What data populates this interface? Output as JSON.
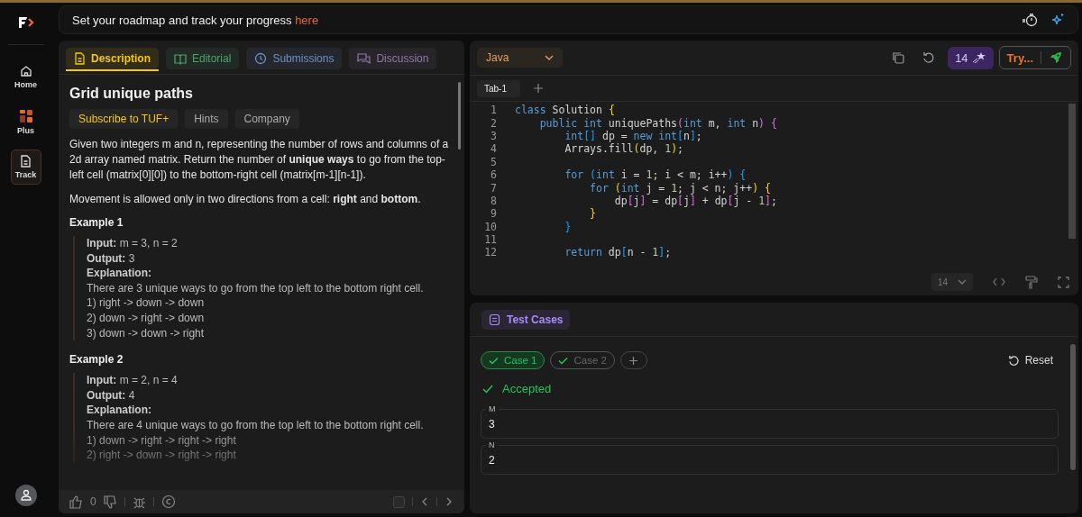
{
  "sidebar": {
    "items": [
      {
        "label": "Home",
        "selected": false
      },
      {
        "label": "Plus",
        "selected": false
      },
      {
        "label": "Track",
        "selected": true
      }
    ]
  },
  "banner": {
    "text": "Set your roadmap and track your progress ",
    "link": "here"
  },
  "problem": {
    "tabs": [
      {
        "label": "Description",
        "color": "#f5c518",
        "selected": true
      },
      {
        "label": "Editorial",
        "color": "#4fa36a",
        "selected": false
      },
      {
        "label": "Submissions",
        "color": "#6f8fc4",
        "selected": false
      },
      {
        "label": "Discussion",
        "color": "#8b7aa8",
        "selected": false
      }
    ],
    "title": "Grid unique paths",
    "chips": [
      {
        "label": "Subscribe to TUF+",
        "kind": "premium"
      },
      {
        "label": "Hints",
        "kind": "plain"
      },
      {
        "label": "Company",
        "kind": "plain"
      }
    ],
    "paragraphs": [
      "Given two integers m and n, representing the number of rows and columns of a 2d array named matrix. Return the number of **unique ways** to go from the top-left cell (matrix[0][0]) to the bottom-right cell (matrix[m-1][n-1]).",
      " Movement is allowed only in two directions from a cell: **right** and **bottom**."
    ],
    "examples": [
      {
        "heading": "Example 1",
        "lines": [
          "**Input:** m = 3, n = 2",
          "**Output:** 3",
          "**Explanation:**",
          "There are 3 unique ways to go from the top left to the bottom right cell.",
          "1) right -> down -> down",
          "2) down -> right -> down",
          "3) down -> down -> right"
        ]
      },
      {
        "heading": "Example 2",
        "lines": [
          "**Input:** m = 2, n = 4",
          "**Output:** 4",
          "**Explanation:**",
          "There are 4 unique ways to go from the top left to the bottom right cell.",
          "1) down -> right -> right -> right",
          "2) right -> down -> right -> right"
        ]
      }
    ],
    "footer": {
      "likes": "0"
    }
  },
  "editor": {
    "language": "Java",
    "streak": "14",
    "try_button": "Try...",
    "tabs": [
      {
        "label": "Tab-1",
        "selected": true
      }
    ],
    "font_size": "14",
    "lines": [
      {
        "number": "1",
        "tokens": [
          {
            "text": "class",
            "kind": "kw"
          },
          {
            "text": " Solution ",
            "kind": "plain"
          },
          {
            "text": "{",
            "kind": "b1"
          }
        ]
      },
      {
        "number": "2",
        "tokens": [
          {
            "text": "    public int",
            "kind": "kw"
          },
          {
            "text": " uniquePaths",
            "kind": "plain"
          },
          {
            "text": "(",
            "kind": "b2"
          },
          {
            "text": "int",
            "kind": "kw"
          },
          {
            "text": " m, ",
            "kind": "plain"
          },
          {
            "text": "int",
            "kind": "kw"
          },
          {
            "text": " n",
            "kind": "plain"
          },
          {
            "text": ") {",
            "kind": "b2"
          }
        ]
      },
      {
        "number": "3",
        "tokens": [
          {
            "text": "        int",
            "kind": "kw"
          },
          {
            "text": "[]",
            "kind": "b3"
          },
          {
            "text": " dp = ",
            "kind": "plain"
          },
          {
            "text": "new int",
            "kind": "kw"
          },
          {
            "text": "[",
            "kind": "b3"
          },
          {
            "text": "n",
            "kind": "plain"
          },
          {
            "text": "]",
            "kind": "b3"
          },
          {
            "text": ";",
            "kind": "plain"
          }
        ]
      },
      {
        "number": "4",
        "tokens": [
          {
            "text": "        Arrays.fill",
            "kind": "plain"
          },
          {
            "text": "(",
            "kind": "b1"
          },
          {
            "text": "dp, ",
            "kind": "plain"
          },
          {
            "text": "1",
            "kind": "num"
          },
          {
            "text": ")",
            "kind": "b1"
          },
          {
            "text": ";",
            "kind": "plain"
          }
        ]
      },
      {
        "number": "5"
      },
      {
        "number": "6",
        "tokens": [
          {
            "text": "        for",
            "kind": "kw"
          },
          {
            "text": " (",
            "kind": "b3"
          },
          {
            "text": "int",
            "kind": "kw"
          },
          {
            "text": " i = ",
            "kind": "plain"
          },
          {
            "text": "1",
            "kind": "num"
          },
          {
            "text": "; i < m; i++",
            "kind": "plain"
          },
          {
            "text": ") {",
            "kind": "b3"
          }
        ]
      },
      {
        "number": "7",
        "tokens": [
          {
            "text": "            for",
            "kind": "kw"
          },
          {
            "text": " (",
            "kind": "b1"
          },
          {
            "text": "int",
            "kind": "kw"
          },
          {
            "text": " j = ",
            "kind": "plain"
          },
          {
            "text": "1",
            "kind": "num"
          },
          {
            "text": "; j < n; j++",
            "kind": "plain"
          },
          {
            "text": ") {",
            "kind": "b1"
          }
        ]
      },
      {
        "number": "8",
        "tokens": [
          {
            "text": "                dp",
            "kind": "plain"
          },
          {
            "text": "[",
            "kind": "b2"
          },
          {
            "text": "j",
            "kind": "plain"
          },
          {
            "text": "]",
            "kind": "b2"
          },
          {
            "text": " = dp",
            "kind": "plain"
          },
          {
            "text": "[",
            "kind": "b2"
          },
          {
            "text": "j",
            "kind": "plain"
          },
          {
            "text": "]",
            "kind": "b2"
          },
          {
            "text": " + dp",
            "kind": "plain"
          },
          {
            "text": "[",
            "kind": "b2"
          },
          {
            "text": "j - ",
            "kind": "plain"
          },
          {
            "text": "1",
            "kind": "num"
          },
          {
            "text": "]",
            "kind": "b2"
          },
          {
            "text": ";",
            "kind": "plain"
          }
        ]
      },
      {
        "number": "9",
        "tokens": [
          {
            "text": "            }",
            "kind": "b1"
          }
        ]
      },
      {
        "number": "10",
        "tokens": [
          {
            "text": "        }",
            "kind": "b3"
          }
        ]
      },
      {
        "number": "11"
      },
      {
        "number": "12",
        "tokens": [
          {
            "text": "        return",
            "kind": "kw"
          },
          {
            "text": " dp",
            "kind": "plain"
          },
          {
            "text": "[",
            "kind": "b3"
          },
          {
            "text": "n - ",
            "kind": "plain"
          },
          {
            "text": "1",
            "kind": "num"
          },
          {
            "text": "]",
            "kind": "b3"
          },
          {
            "text": ";",
            "kind": "plain"
          }
        ]
      }
    ]
  },
  "tests": {
    "title": "Test Cases",
    "reset": "Reset",
    "cases": [
      {
        "label": "Case 1",
        "selected": true
      },
      {
        "label": "Case 2",
        "selected": false
      }
    ],
    "status": "Accepted",
    "fields": [
      {
        "label": "M",
        "value": "3"
      },
      {
        "label": "N",
        "value": "2"
      }
    ]
  }
}
